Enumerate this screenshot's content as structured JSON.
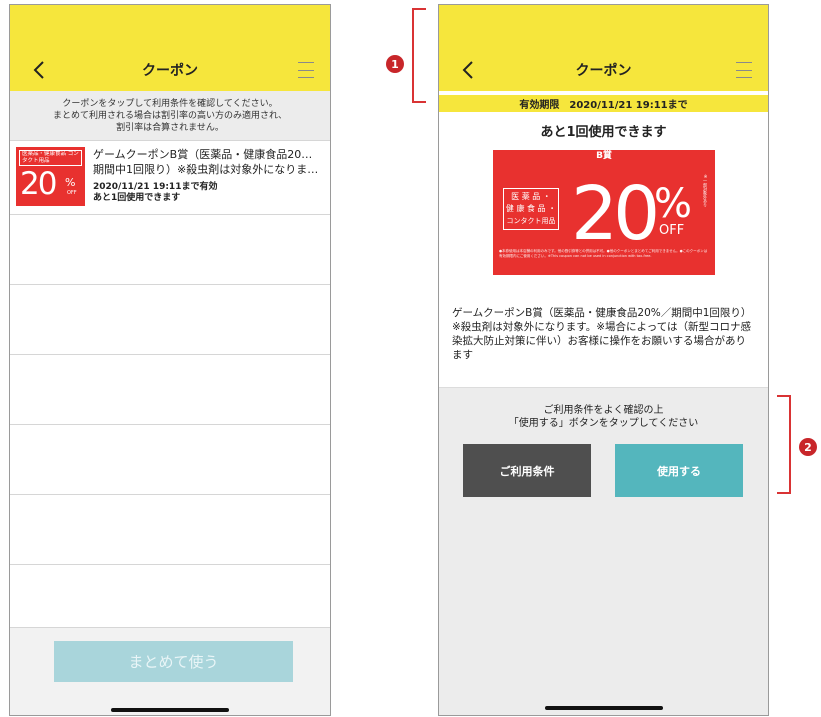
{
  "left_screen": {
    "header": {
      "title": "クーポン"
    },
    "notice": {
      "lines": [
        "クーポンをタップして利用条件を確認してください。",
        "まとめて利用される場合は割引率の高い方のみ適用され、",
        "割引率は合算されません。"
      ]
    },
    "coupon": {
      "thumb": {
        "category": "医薬品・健康食品 コンタクト用品",
        "percent": "20",
        "percent_sign": "%",
        "off": "OFF"
      },
      "name_line1": "ゲームクーポンB賞（医薬品・健康食品20%／",
      "name_line2": "期間中1回限り）※殺虫剤は対象外になります…",
      "expiry": "2020/11/21 19:11まで有効",
      "remaining": "あと1回使用できます"
    },
    "bulk_button": "まとめて使う"
  },
  "right_screen": {
    "header": {
      "title": "クーポン"
    },
    "expiry": "有効期限　2020/11/21 19:11まで",
    "remaining": "あと1回使用できます",
    "coupon_image": {
      "label": "B賞",
      "category_lines": [
        "医 薬 品 ・",
        "健 康 食 品 ・",
        "コンタクト用品"
      ],
      "percent": "20",
      "percent_sign": "%",
      "off": "OFF",
      "side_note": "※一部対象外あり",
      "fine_print": "●本券使用は本店舗の利用のみです。他の割引券等との併用は不可。●他のクーポンとまとめてご利用できません。●このクーポンは有効期限内にご使用ください。※This coupon can not be used in conjunction with tax-free."
    },
    "description": "ゲームクーポンB賞（医薬品・健康食品20%／期間中1回限り）※殺虫剤は対象外になります。※場合によっては（新型コロナ感染拡大防止対策に伴い）お客様に操作をお願いする場合があります",
    "confirm_line1": "ご利用条件をよく確認の上",
    "confirm_line2": "「使用する」ボタンをタップしてください",
    "terms_button": "ご利用条件",
    "use_button": "使用する"
  },
  "annotations": {
    "marker_1": "1",
    "marker_2": "2"
  },
  "colors": {
    "header_yellow": "#f6e63c",
    "coupon_red": "#e8312f",
    "use_teal": "#54b6bd",
    "terms_gray": "#4f4f4f",
    "bulk_disabled": "#a9d5db",
    "annotation_red": "#d93334"
  },
  "icons": {
    "back": "chevron-left-icon",
    "menu": "hamburger-menu-icon"
  }
}
